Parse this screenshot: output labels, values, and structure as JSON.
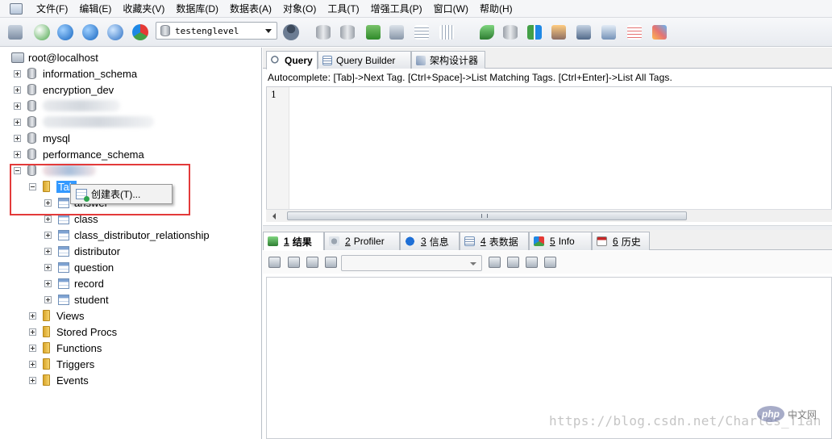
{
  "menu": [
    "文件(F)",
    "编辑(E)",
    "收藏夹(V)",
    "数据库(D)",
    "数据表(A)",
    "对象(O)",
    "工具(T)",
    "增强工具(P)",
    "窗口(W)",
    "帮助(H)"
  ],
  "toolbar": {
    "database_selected": "testenglevel"
  },
  "tree": {
    "root": "root@localhost",
    "databases": [
      "information_schema",
      "encryption_dev",
      "",
      "",
      "mysql",
      "performance_schema"
    ],
    "tables_folder": "Tab",
    "tables": [
      "answer",
      "class",
      "class_distributor_relationship",
      "distributor",
      "question",
      "record",
      "student"
    ],
    "folders": [
      "Views",
      "Stored Procs",
      "Functions",
      "Triggers",
      "Events"
    ]
  },
  "context_menu": {
    "item": "创建表(T)..."
  },
  "query_tabs": [
    "Query",
    "Query Builder",
    "架构设计器"
  ],
  "autocomplete_hint": "Autocomplete: [Tab]->Next Tag. [Ctrl+Space]->List Matching Tags. [Ctrl+Enter]->List All Tags.",
  "editor": {
    "line_number": "1"
  },
  "result_tabs": [
    {
      "num": "1",
      "label": "结果"
    },
    {
      "num": "2",
      "label": "Profiler"
    },
    {
      "num": "3",
      "label": "信息"
    },
    {
      "num": "4",
      "label": "表数据"
    },
    {
      "num": "5",
      "label": "Info"
    },
    {
      "num": "6",
      "label": "历史"
    }
  ],
  "watermark": "https://blog.csdn.net/Charles_Tian",
  "php_logo": {
    "badge": "php",
    "text": "中文网"
  },
  "colors": {
    "selection": "#3399ff",
    "highlight_box": "#e33a3a"
  }
}
